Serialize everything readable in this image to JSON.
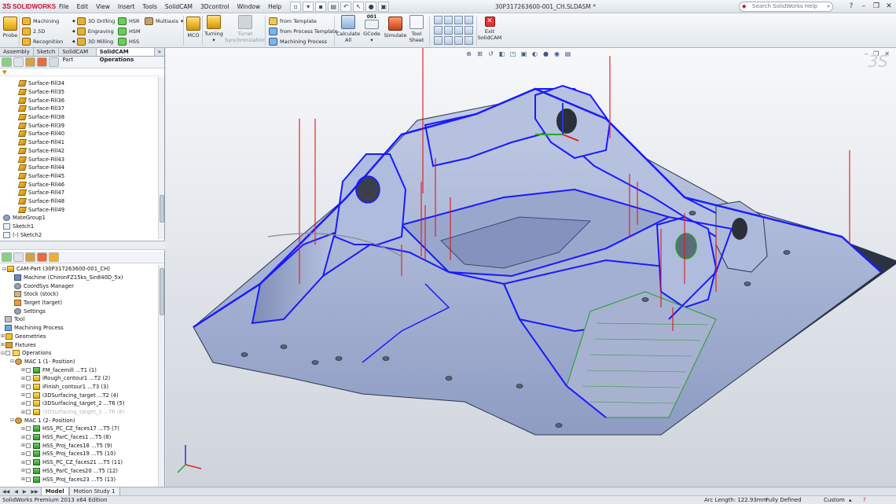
{
  "app": {
    "logo_text": "SOLIDWORKS",
    "doc_title": "30P317263600-001_CH.SLDASM *"
  },
  "menu": [
    "File",
    "Edit",
    "View",
    "Insert",
    "Tools",
    "SolidCAM",
    "3Dcontrol",
    "Window",
    "Help"
  ],
  "help_search": {
    "placeholder": "Search SolidWorks Help"
  },
  "ribbon": {
    "probe": "Probe",
    "machining": "Machining",
    "d25": "2.5D",
    "recognition": "Recognition",
    "drilling3d": "3D Drilling",
    "engraving": "Engraving",
    "milling3d": "3D Milling",
    "hsr": "HSR",
    "hsm": "HSM",
    "hss": "HSS",
    "multiaxis": "Multiaxis",
    "mco": "MCO",
    "turning": "Turning",
    "turret_sync": [
      "Turret",
      "Synchronization"
    ],
    "from_template": "from Template",
    "from_process_template": "from Process Template",
    "machining_process": "Machining Process",
    "calculate_all": [
      "Calculate",
      "All"
    ],
    "gcode": "GCode",
    "gcode_badge": "001",
    "simulate": "Simulate",
    "tool_sheet": [
      "Tool",
      "Sheet"
    ],
    "exit_solidcam": [
      "Exit",
      "SolidCAM"
    ]
  },
  "panel_tabs": [
    "Assembly",
    "Sketch",
    "SolidCAM Part",
    "SolidCAM Operations"
  ],
  "feature_tree": {
    "surfaces": [
      "Surface-Fill34",
      "Surface-Fill35",
      "Surface-Fill36",
      "Surface-Fill37",
      "Surface-Fill38",
      "Surface-Fill39",
      "Surface-Fill40",
      "Surface-Fill41",
      "Surface-Fill42",
      "Surface-Fill43",
      "Surface-Fill44",
      "Surface-Fill45",
      "Surface-Fill46",
      "Surface-Fill47",
      "Surface-Fill48",
      "Surface-Fill49"
    ],
    "mategroup": "MateGroup1",
    "sketch1": "Sketch1",
    "sketch2": "(-) Sketch2"
  },
  "cam_tree": {
    "cam_part": "CAM-Part (30P317263600-001_CH)",
    "machine": "Machine (ChironFZ15ks_Sin840D_5x)",
    "coordsys": "CoordSys Manager",
    "stock": "Stock (stock)",
    "target": "Target (target)",
    "settings": "Settings",
    "tool": "Tool",
    "machining_process": "Machining Process",
    "geometries": "Geometries",
    "fixtures": "Fixtures",
    "operations": "Operations",
    "mac1": "MAC 1 (1- Position)",
    "ops1": [
      "FM_facemill ...T1 (1)",
      "iRough_contour1 ...T2 (2)",
      "iFinish_contour1 ...T3 (3)",
      "i3DSurfacing_target ...T2 (4)",
      "i3DSurfacing_target_2 ...T6 (5)",
      "i3DSurfacing_target_3 ...T6 (6)"
    ],
    "mac2": "MAC 1 (2- Position)",
    "ops2": [
      "HSS_PC_CZ_faces17 ...T5 (7)",
      "HSS_ParC_faces1 ...T5 (8)",
      "HSS_Proj_faces18 ...T5 (9)",
      "HSS_Proj_faces19 ...T5 (10)",
      "HSS_PC_CZ_faces21 ...T5 (11)",
      "HSS_ParC_faces20 ...T5 (12)",
      "HSS_Proj_faces23 ...T5 (13)"
    ]
  },
  "bottom_tabs": [
    "Model",
    "Motion Study 1"
  ],
  "status": {
    "edition": "SolidWorks Premium 2013 x64 Edition",
    "arc_length": "Arc Length: 122.93mm",
    "defined": "Fully Defined",
    "custom": "Custom"
  },
  "colors": {
    "part_face": "#a9b6d9",
    "part_dark": "#2c3444",
    "toolpath": "#1a1aff",
    "retract": "#e01818",
    "contour": "#2a9b2a"
  }
}
